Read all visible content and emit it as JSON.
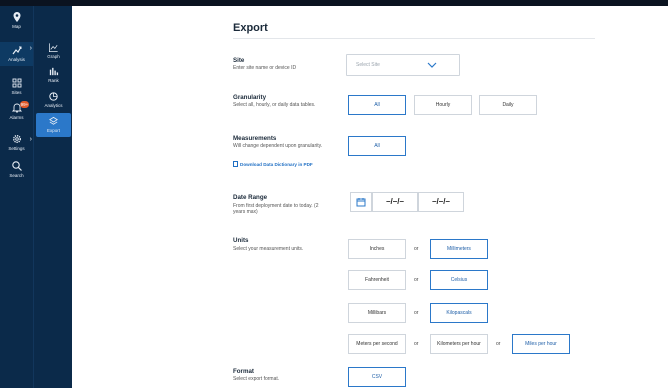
{
  "rail": {
    "items": [
      {
        "label": "Map"
      },
      {
        "label": "Analysis"
      },
      {
        "label": "Sites"
      },
      {
        "label": "Alarms",
        "badge": "99+"
      },
      {
        "label": "Settings"
      },
      {
        "label": "Search"
      }
    ]
  },
  "subrail": {
    "items": [
      {
        "label": "Graph"
      },
      {
        "label": "Rank"
      },
      {
        "label": "Analytics"
      },
      {
        "label": "Export"
      }
    ]
  },
  "page": {
    "title": "Export"
  },
  "site": {
    "label": "Site",
    "desc": "Enter site name or device ID",
    "placeholder": "Select Site"
  },
  "granularity": {
    "label": "Granularity",
    "desc": "Select all, hourly, or daily data tables.",
    "options": [
      "All",
      "Hourly",
      "Daily"
    ],
    "selected": "All"
  },
  "measurements": {
    "label": "Measurements",
    "desc": "Will change dependent upon granularity.",
    "link": "Download Data Dictionary in PDF",
    "options": [
      "All"
    ]
  },
  "date_range": {
    "label": "Date Range",
    "desc": "From first deployment date to today. (2 years max)",
    "start": "–/–/–",
    "end": "–/–/–"
  },
  "units": {
    "label": "Units",
    "desc": "Select your measurement units.",
    "or": "or",
    "length": [
      "Inches",
      "Millimeters"
    ],
    "temperature": [
      "Fahrenheit",
      "Celsius"
    ],
    "pressure": [
      "Millibars",
      "Kilopascals"
    ],
    "speed": [
      "Meters per second",
      "Kilometers per hour",
      "Miles per hour"
    ]
  },
  "format": {
    "label": "Format",
    "desc": "Select export format.",
    "options": [
      "CSV"
    ]
  },
  "colors": {
    "rail": "#0b2a4a",
    "accent": "#2b78c9"
  }
}
